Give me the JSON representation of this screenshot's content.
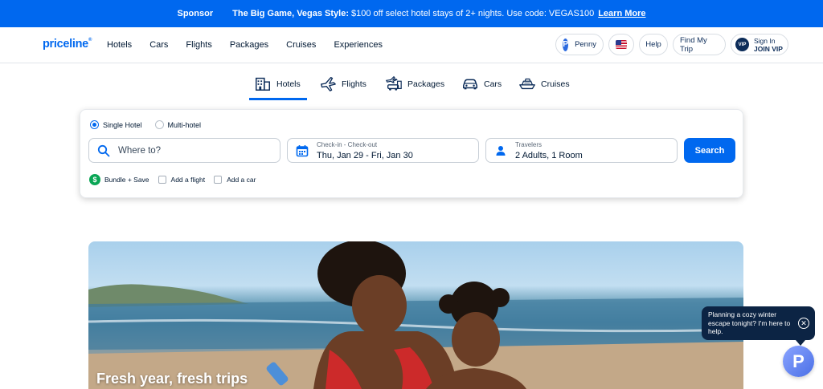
{
  "promo": {
    "sponsor": "Sponsor",
    "headline": "The Big Game, Vegas Style:",
    "text": "$100 off select hotel stays of 2+ nights. Use code: VEGAS100",
    "link": "Learn More"
  },
  "header": {
    "logo": "priceline",
    "nav": [
      "Hotels",
      "Cars",
      "Flights",
      "Packages",
      "Cruises",
      "Experiences"
    ],
    "penny_label": "Penny",
    "penny_initial": "P",
    "help": "Help",
    "find_trip": "Find My Trip",
    "vip_badge": "VIP",
    "sign_in": "Sign In",
    "join_vip": "JOIN VIP"
  },
  "product_tabs": [
    {
      "label": "Hotels",
      "icon": "hotel-icon",
      "active": true
    },
    {
      "label": "Flights",
      "icon": "plane-icon",
      "active": false
    },
    {
      "label": "Packages",
      "icon": "package-icon",
      "active": false
    },
    {
      "label": "Cars",
      "icon": "car-icon",
      "active": false
    },
    {
      "label": "Cruises",
      "icon": "cruise-icon",
      "active": false
    }
  ],
  "search": {
    "single_hotel": "Single Hotel",
    "multi_hotel": "Multi-hotel",
    "where_placeholder": "Where to?",
    "dates_label": "Check-in - Check-out",
    "dates_value": "Thu, Jan 29 - Fri, Jan 30",
    "travelers_label": "Travelers",
    "travelers_value": "2 Adults, 1 Room",
    "search_button": "Search",
    "bundle_label": "Bundle + Save",
    "add_flight": "Add a flight",
    "add_car": "Add a car"
  },
  "hero": {
    "title": "Fresh year, fresh trips"
  },
  "chat": {
    "message": "Planning a cozy winter escape tonight? I'm here to help.",
    "fab_initial": "P"
  },
  "colors": {
    "brand_blue": "#0068ef",
    "navy": "#0c2444",
    "bundle_green": "#0aa655"
  }
}
